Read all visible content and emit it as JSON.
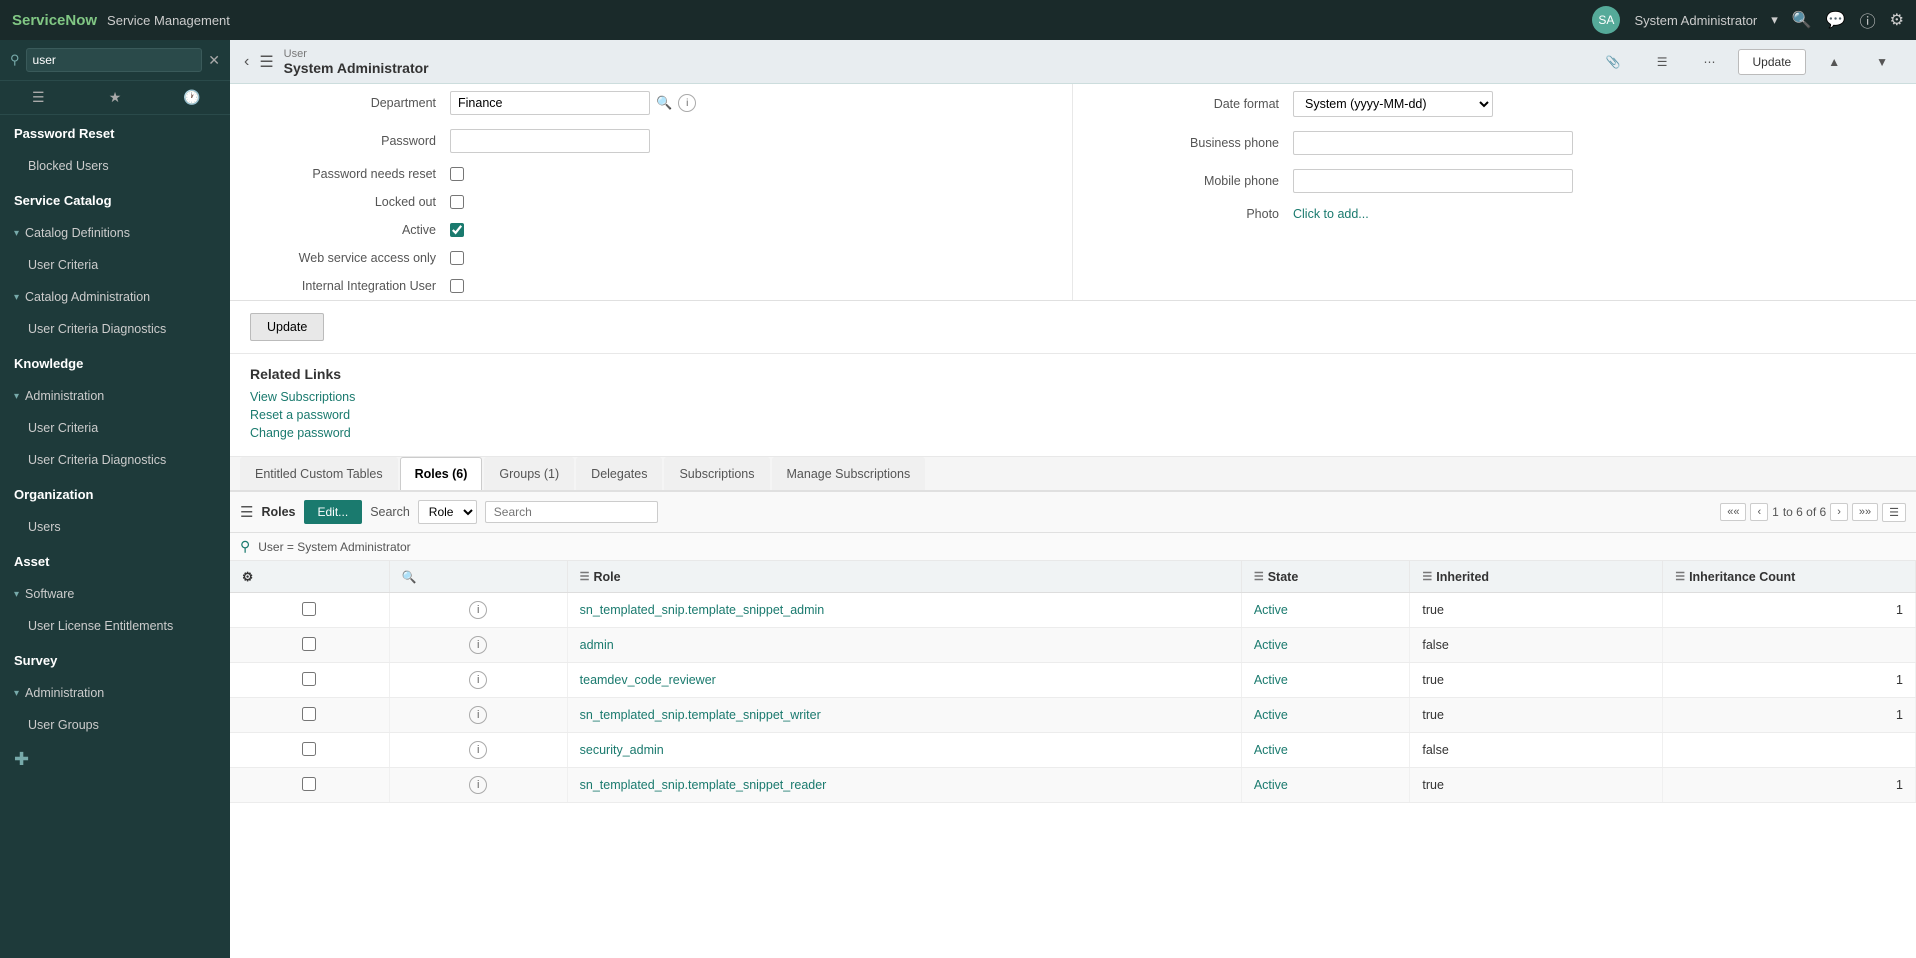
{
  "app": {
    "logo": "ServiceNow",
    "title": "Service Management"
  },
  "topnav": {
    "user": "System Administrator",
    "icons": [
      "search",
      "chat",
      "help",
      "settings"
    ]
  },
  "sidebar": {
    "search_placeholder": "user",
    "sections": [
      {
        "id": "password-reset",
        "label": "Password Reset",
        "type": "section",
        "indent": 0
      },
      {
        "id": "blocked-users",
        "label": "Blocked Users",
        "type": "item",
        "indent": 1
      },
      {
        "id": "service-catalog",
        "label": "Service Catalog",
        "type": "section",
        "indent": 0
      },
      {
        "id": "catalog-definitions",
        "label": "▾ Catalog Definitions",
        "type": "section",
        "indent": 0
      },
      {
        "id": "user-criteria-1",
        "label": "User Criteria",
        "type": "item",
        "indent": 1
      },
      {
        "id": "catalog-administration",
        "label": "▾ Catalog Administration",
        "type": "section",
        "indent": 0
      },
      {
        "id": "user-criteria-diagnostics-1",
        "label": "User Criteria Diagnostics",
        "type": "item",
        "indent": 1
      },
      {
        "id": "knowledge",
        "label": "Knowledge",
        "type": "section",
        "indent": 0
      },
      {
        "id": "administration-1",
        "label": "▾ Administration",
        "type": "section",
        "indent": 0
      },
      {
        "id": "user-criteria-2",
        "label": "User Criteria",
        "type": "item",
        "indent": 1
      },
      {
        "id": "user-criteria-diagnostics-2",
        "label": "User Criteria Diagnostics",
        "type": "item",
        "indent": 1
      },
      {
        "id": "organization",
        "label": "Organization",
        "type": "section",
        "indent": 0
      },
      {
        "id": "users",
        "label": "Users",
        "type": "item",
        "indent": 1
      },
      {
        "id": "asset",
        "label": "Asset",
        "type": "section",
        "indent": 0
      },
      {
        "id": "software",
        "label": "▾ Software",
        "type": "section",
        "indent": 0
      },
      {
        "id": "user-license-entitlements",
        "label": "User License Entitlements",
        "type": "item",
        "indent": 1
      },
      {
        "id": "survey",
        "label": "Survey",
        "type": "section",
        "indent": 0
      },
      {
        "id": "administration-2",
        "label": "▾ Administration",
        "type": "section",
        "indent": 0
      },
      {
        "id": "user-groups",
        "label": "User Groups",
        "type": "item",
        "indent": 1
      }
    ]
  },
  "content_header": {
    "breadcrumb": "User",
    "title": "System Administrator"
  },
  "form": {
    "left": [
      {
        "id": "department",
        "label": "Department",
        "type": "lookup",
        "value": "Finance"
      },
      {
        "id": "password",
        "label": "Password",
        "type": "password",
        "value": ""
      },
      {
        "id": "password_needs_reset",
        "label": "Password needs reset",
        "type": "checkbox",
        "checked": false
      },
      {
        "id": "locked_out",
        "label": "Locked out",
        "type": "checkbox",
        "checked": false
      },
      {
        "id": "active",
        "label": "Active",
        "type": "checkbox",
        "checked": true
      },
      {
        "id": "web_service_access_only",
        "label": "Web service access only",
        "type": "checkbox",
        "checked": false
      },
      {
        "id": "internal_integration_user",
        "label": "Internal Integration User",
        "type": "checkbox",
        "checked": false
      }
    ],
    "right": [
      {
        "id": "date_format",
        "label": "Date format",
        "type": "select",
        "value": "System (yyyy-MM-dd)"
      },
      {
        "id": "business_phone",
        "label": "Business phone",
        "type": "text",
        "value": ""
      },
      {
        "id": "mobile_phone",
        "label": "Mobile phone",
        "type": "text",
        "value": ""
      },
      {
        "id": "photo",
        "label": "Photo",
        "type": "link",
        "value": "Click to add..."
      }
    ]
  },
  "update_btn": "Update",
  "related_links": {
    "title": "Related Links",
    "links": [
      {
        "id": "view-subscriptions",
        "label": "View Subscriptions"
      },
      {
        "id": "reset-password",
        "label": "Reset a password"
      },
      {
        "id": "change-password",
        "label": "Change password"
      }
    ]
  },
  "tabs": [
    {
      "id": "entitled-custom-tables",
      "label": "Entitled Custom Tables",
      "active": false
    },
    {
      "id": "roles",
      "label": "Roles (6)",
      "active": true
    },
    {
      "id": "groups",
      "label": "Groups (1)",
      "active": false
    },
    {
      "id": "delegates",
      "label": "Delegates",
      "active": false
    },
    {
      "id": "subscriptions",
      "label": "Subscriptions",
      "active": false
    },
    {
      "id": "manage-subscriptions",
      "label": "Manage Subscriptions",
      "active": false
    }
  ],
  "table_toolbar": {
    "roles_label": "Roles",
    "edit_label": "Edit...",
    "search_label": "Search",
    "role_filter_option": "Role",
    "search_placeholder": "Search",
    "pagination": {
      "current": "1",
      "total": "to 6 of 6"
    }
  },
  "filter_bar": {
    "text": "User = System Administrator"
  },
  "table": {
    "headers": [
      {
        "id": "role",
        "label": "Role"
      },
      {
        "id": "state",
        "label": "State"
      },
      {
        "id": "inherited",
        "label": "Inherited"
      },
      {
        "id": "inheritance_count",
        "label": "Inheritance Count"
      }
    ],
    "rows": [
      {
        "id": 1,
        "role": "sn_templated_snip.template_snippet_admin",
        "state": "Active",
        "inherited": "true",
        "count": "1"
      },
      {
        "id": 2,
        "role": "admin",
        "state": "Active",
        "inherited": "false",
        "count": ""
      },
      {
        "id": 3,
        "role": "teamdev_code_reviewer",
        "state": "Active",
        "inherited": "true",
        "count": "1"
      },
      {
        "id": 4,
        "role": "sn_templated_snip.template_snippet_writer",
        "state": "Active",
        "inherited": "true",
        "count": "1"
      },
      {
        "id": 5,
        "role": "security_admin",
        "state": "Active",
        "inherited": "false",
        "count": ""
      },
      {
        "id": 6,
        "role": "sn_templated_snip.template_snippet_reader",
        "state": "Active",
        "inherited": "true",
        "count": "1"
      }
    ]
  },
  "colors": {
    "sidebar_bg": "#1e3a3a",
    "topnav_bg": "#1a2a2a",
    "accent": "#1a7a6e",
    "tab_active_bg": "#ffffff"
  }
}
